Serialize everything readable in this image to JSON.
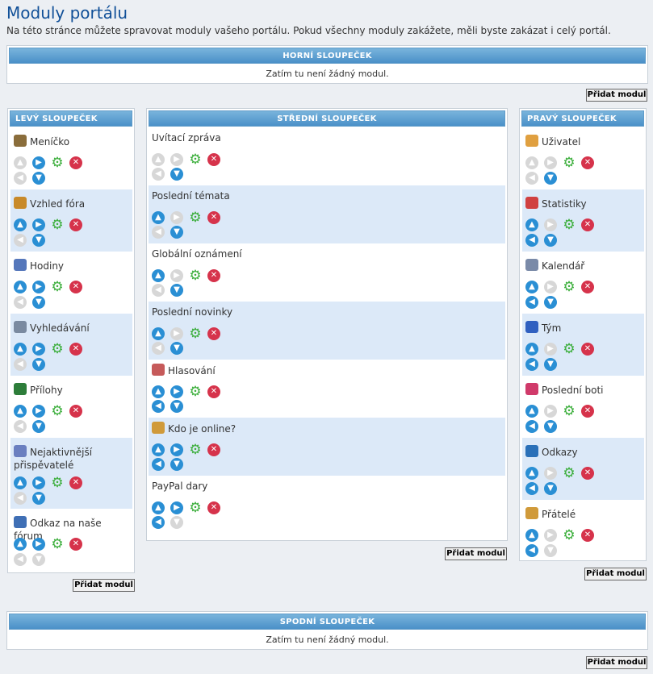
{
  "page": {
    "title": "Moduly portálu",
    "description": "Na této stránce můžete spravovat moduly vašeho portálu. Pokud všechny moduly zakážete, měli byste zakázat i celý portál."
  },
  "top": {
    "header": "HORNÍ SLOUPEČEK",
    "empty": "Zatím tu není žádný modul.",
    "add_label": "Přidat modul"
  },
  "bottom": {
    "header": "SPODNÍ SLOUPEČEK",
    "empty": "Zatím tu není žádný modul.",
    "add_label": "Přidat modul"
  },
  "left": {
    "header": "LEVÝ SLOUPEČEK",
    "add_label": "Přidat modul",
    "modules": [
      {
        "name": "Meníčko",
        "icon": "menu-icon",
        "icon_color": "#8a6d3b",
        "up": false,
        "right": true,
        "left": false,
        "down": true
      },
      {
        "name": "Vzhled fóra",
        "icon": "palette-icon",
        "icon_color": "#c88a2a",
        "up": true,
        "right": true,
        "left": false,
        "down": true
      },
      {
        "name": "Hodiny",
        "icon": "clock-icon",
        "icon_color": "#5577bb",
        "up": true,
        "right": true,
        "left": false,
        "down": true
      },
      {
        "name": "Vyhledávání",
        "icon": "search-icon",
        "icon_color": "#7a8aa0",
        "up": true,
        "right": true,
        "left": false,
        "down": true
      },
      {
        "name": "Přílohy",
        "icon": "books-icon",
        "icon_color": "#2d7d3a",
        "up": true,
        "right": true,
        "left": false,
        "down": true
      },
      {
        "name": "Nejaktivnější přispěvatelé",
        "icon": "edit-icon",
        "icon_color": "#6a7fc0",
        "up": true,
        "right": true,
        "left": false,
        "down": true
      },
      {
        "name": "Odkaz na naše fórum",
        "icon": "list-icon",
        "icon_color": "#3f6fb5",
        "up": true,
        "right": true,
        "left": false,
        "down": false
      }
    ]
  },
  "center": {
    "header": "STŘEDNÍ SLOUPEČEK",
    "add_label": "Přidat modul",
    "modules": [
      {
        "name": "Uvítací zpráva",
        "icon": "",
        "icon_color": "",
        "up": false,
        "right": false,
        "left": false,
        "down": true
      },
      {
        "name": "Poslední témata",
        "icon": "",
        "icon_color": "",
        "up": true,
        "right": false,
        "left": false,
        "down": true
      },
      {
        "name": "Globální oznámení",
        "icon": "",
        "icon_color": "",
        "up": true,
        "right": false,
        "left": false,
        "down": true
      },
      {
        "name": "Poslední novinky",
        "icon": "",
        "icon_color": "",
        "up": true,
        "right": false,
        "left": false,
        "down": true
      },
      {
        "name": "Hlasování",
        "icon": "poll-icon",
        "icon_color": "#c65a5a",
        "up": true,
        "right": true,
        "left": true,
        "down": true
      },
      {
        "name": "Kdo je online?",
        "icon": "users-online-icon",
        "icon_color": "#d09a3a",
        "up": true,
        "right": true,
        "left": true,
        "down": true
      },
      {
        "name": "PayPal dary",
        "icon": "",
        "icon_color": "",
        "up": true,
        "right": true,
        "left": true,
        "down": false
      }
    ]
  },
  "right": {
    "header": "PRAVÝ SLOUPEČEK",
    "add_label": "Přidat modul",
    "modules": [
      {
        "name": "Uživatel",
        "icon": "user-icon",
        "icon_color": "#e0a040",
        "up": false,
        "right": false,
        "left": false,
        "down": true
      },
      {
        "name": "Statistiky",
        "icon": "stats-icon",
        "icon_color": "#d04040",
        "up": true,
        "right": false,
        "left": true,
        "down": true
      },
      {
        "name": "Kalendář",
        "icon": "calendar-icon",
        "icon_color": "#7a8aa8",
        "up": true,
        "right": false,
        "left": true,
        "down": true
      },
      {
        "name": "Tým",
        "icon": "team-icon",
        "icon_color": "#3060c0",
        "up": true,
        "right": false,
        "left": true,
        "down": true
      },
      {
        "name": "Poslední boti",
        "icon": "bots-icon",
        "icon_color": "#d03a6a",
        "up": true,
        "right": false,
        "left": true,
        "down": true
      },
      {
        "name": "Odkazy",
        "icon": "links-icon",
        "icon_color": "#2a70b8",
        "up": true,
        "right": false,
        "left": true,
        "down": true
      },
      {
        "name": "Přátelé",
        "icon": "friends-icon",
        "icon_color": "#d09a3a",
        "up": true,
        "right": false,
        "left": true,
        "down": false
      }
    ]
  }
}
